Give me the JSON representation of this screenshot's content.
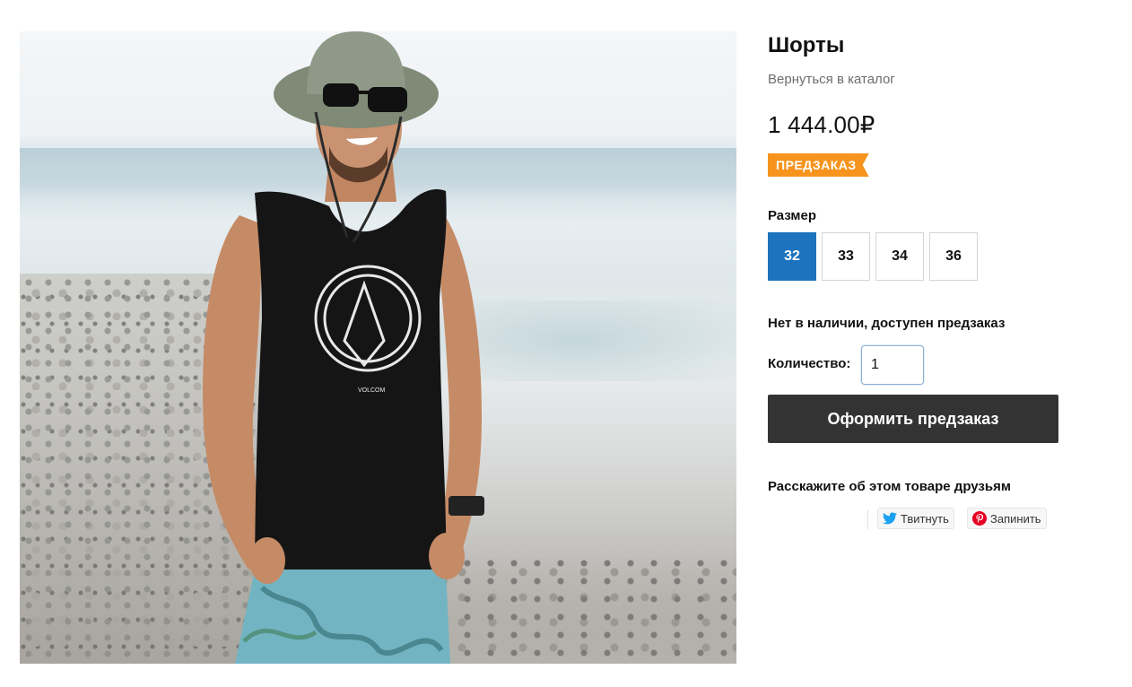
{
  "product": {
    "title": "Шорты",
    "back_link": "Вернуться в каталог",
    "price": "1 444.00₽",
    "badge": "ПРЕДЗАКАЗ",
    "size_label": "Размер",
    "sizes": [
      "32",
      "33",
      "34",
      "36"
    ],
    "selected_size": "32",
    "stock_status": "Нет в наличии, доступен предзаказ",
    "quantity_label": "Количество:",
    "quantity_value": "1",
    "preorder_button": "Оформить предзаказ"
  },
  "photo": {
    "shirt_print": "VOLCOM"
  },
  "share": {
    "label": "Расскажите об этом товаре друзьям",
    "tweet_label": "Твитнуть",
    "pin_label": "Запинить"
  },
  "colors": {
    "accent_blue": "#1e73be",
    "badge_orange": "#f7941d",
    "button_dark": "#333333",
    "twitter_blue": "#1da1f2",
    "pinterest_red": "#e60023"
  },
  "icons": {
    "twitter": "twitter-bird-icon",
    "pinterest": "pinterest-icon"
  }
}
